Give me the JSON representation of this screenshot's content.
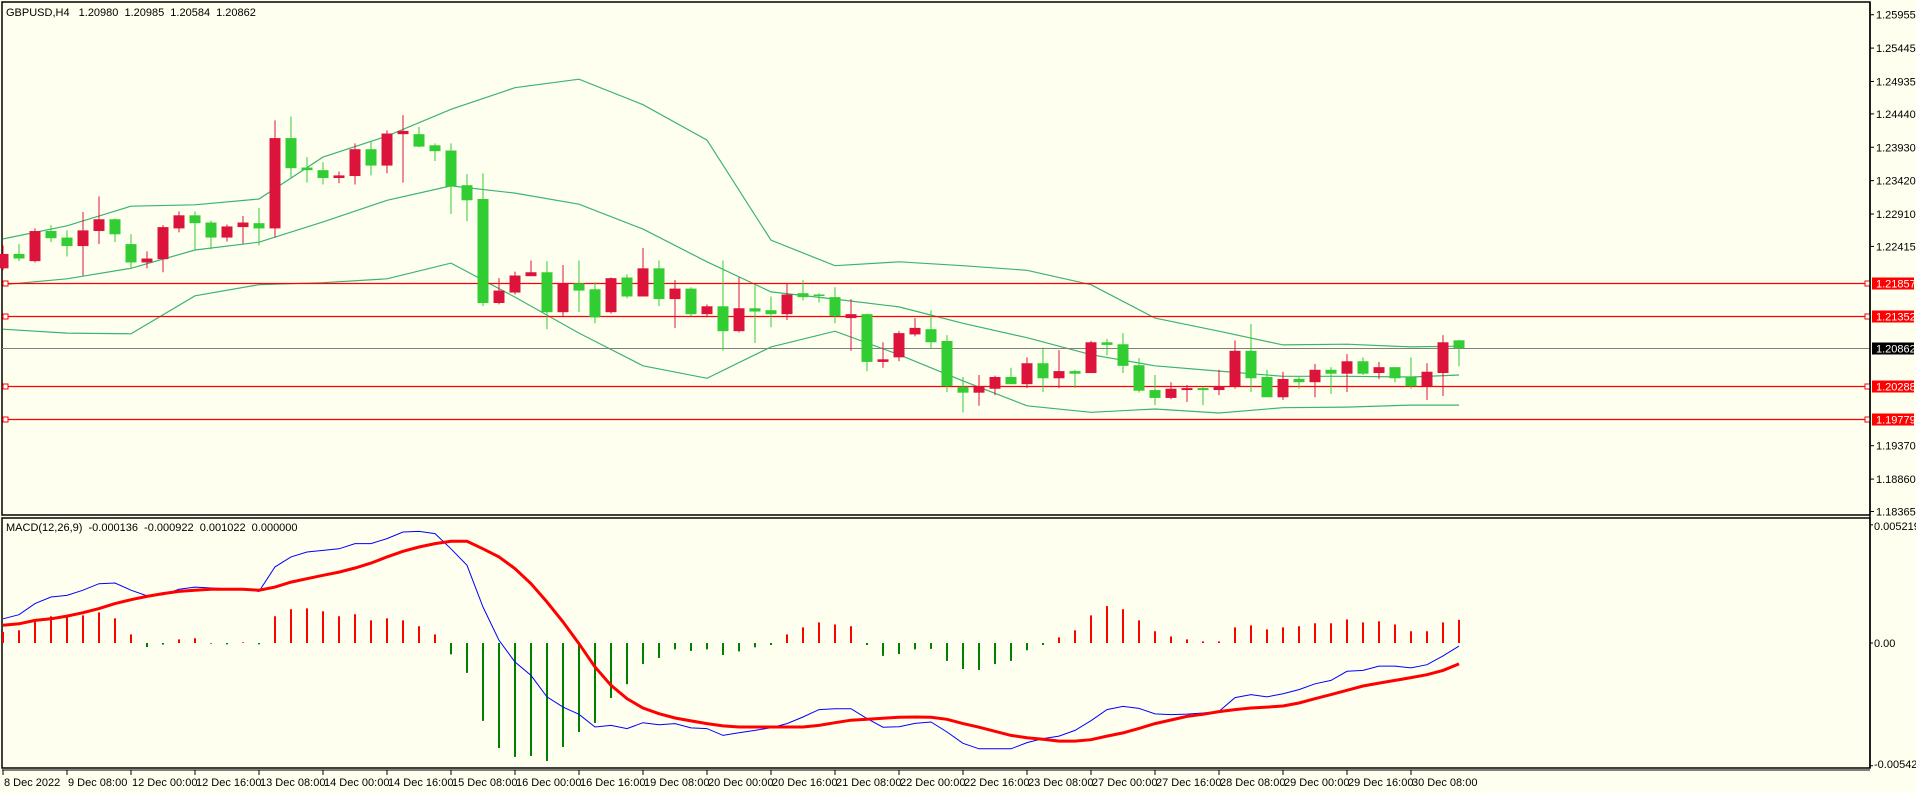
{
  "header": {
    "symbol": "GBPUSD,H4",
    "open": "1.20980",
    "high": "1.20985",
    "low": "1.20584",
    "close": "1.20862"
  },
  "macd_header": {
    "name": "MACD(12,26,9)",
    "v1": "-0.000136",
    "v2": "-0.000922",
    "v3": "0.001022",
    "v4": "0.000000"
  },
  "colors": {
    "background": "#fffff0",
    "bull_candle": "#dc143c",
    "bear_candle": "#32cd32",
    "bands": "#3cb371",
    "level_line": "#ff0000",
    "current_price_line": "#808080",
    "macd_main": "#0000ff",
    "macd_signal": "#ff0000",
    "hist_positive": "#ff0000",
    "hist_negative": "#008000"
  },
  "chart_data": {
    "type": "candlestick",
    "title": "GBPUSD,H4",
    "ylim": [
      1.18311,
      1.2618
    ],
    "price_axis": {
      "ticks": [
        "1.25955",
        "1.25445",
        "1.24935",
        "1.24440",
        "1.23930",
        "1.23420",
        "1.22910",
        "1.22415",
        "1.19370",
        "1.18860",
        "1.18365"
      ]
    },
    "levels": [
      {
        "price": 1.21857,
        "label": "1.21857"
      },
      {
        "price": 1.21352,
        "label": "1.21352"
      },
      {
        "price": 1.20288,
        "label": "1.20288"
      },
      {
        "price": 1.19779,
        "label": "1.19779"
      }
    ],
    "current_price": {
      "price": 1.20862,
      "label": "1.20862"
    },
    "time_axis": {
      "label_every_bars": 4,
      "labels": [
        "8 Dec 2022",
        "9 Dec 08:00",
        "12 Dec 00:00",
        "12 Dec 16:00",
        "13 Dec 08:00",
        "14 Dec 00:00",
        "14 Dec 16:00",
        "15 Dec 08:00",
        "16 Dec 00:00",
        "16 Dec 16:00",
        "19 Dec 08:00",
        "20 Dec 00:00",
        "20 Dec 16:00",
        "21 Dec 08:00",
        "22 Dec 00:00",
        "22 Dec 16:00",
        "23 Dec 08:00",
        "27 Dec 00:00",
        "27 Dec 16:00",
        "28 Dec 08:00",
        "29 Dec 00:00",
        "29 Dec 16:00",
        "30 Dec 08:00"
      ]
    },
    "ohlc": [
      [
        1.2208,
        1.2243,
        1.2205,
        1.223
      ],
      [
        1.223,
        1.2245,
        1.2219,
        1.2223
      ],
      [
        1.2219,
        1.2269,
        1.2217,
        1.2265
      ],
      [
        1.2265,
        1.2274,
        1.2248,
        1.2254
      ],
      [
        1.2255,
        1.2266,
        1.2226,
        1.2242
      ],
      [
        1.2242,
        1.2294,
        1.2197,
        1.2266
      ],
      [
        1.2265,
        1.2318,
        1.2245,
        1.2283
      ],
      [
        1.2283,
        1.2284,
        1.2248,
        1.226
      ],
      [
        1.2245,
        1.226,
        1.2208,
        1.2217
      ],
      [
        1.2217,
        1.2234,
        1.2208,
        1.2223
      ],
      [
        1.2222,
        1.2274,
        1.2202,
        1.2271
      ],
      [
        1.2269,
        1.2295,
        1.2263,
        1.2289
      ],
      [
        1.2289,
        1.2295,
        1.2237,
        1.2277
      ],
      [
        1.2278,
        1.2281,
        1.2237,
        1.2255
      ],
      [
        1.2255,
        1.2275,
        1.2249,
        1.2272
      ],
      [
        1.2271,
        1.2288,
        1.2246,
        1.2278
      ],
      [
        1.2277,
        1.23,
        1.2243,
        1.2269
      ],
      [
        1.2269,
        1.2434,
        1.2255,
        1.2407
      ],
      [
        1.2407,
        1.244,
        1.2347,
        1.2361
      ],
      [
        1.2362,
        1.2378,
        1.2339,
        1.2358
      ],
      [
        1.2358,
        1.237,
        1.2336,
        1.2346
      ],
      [
        1.2346,
        1.2356,
        1.2338,
        1.235
      ],
      [
        1.2349,
        1.2399,
        1.2336,
        1.239
      ],
      [
        1.239,
        1.2401,
        1.235,
        1.2365
      ],
      [
        1.2365,
        1.2419,
        1.2353,
        1.2414
      ],
      [
        1.2413,
        1.2442,
        1.2339,
        1.2418
      ],
      [
        1.2413,
        1.2424,
        1.2393,
        1.2394
      ],
      [
        1.2396,
        1.2399,
        1.2372,
        1.2387
      ],
      [
        1.2388,
        1.2399,
        1.2291,
        1.2333
      ],
      [
        1.2335,
        1.2352,
        1.228,
        1.2312
      ],
      [
        1.2314,
        1.2353,
        1.215,
        1.2155
      ],
      [
        1.2155,
        1.2193,
        1.2153,
        1.2174
      ],
      [
        1.2171,
        1.2203,
        1.2168,
        1.2197
      ],
      [
        1.2196,
        1.222,
        1.2196,
        1.2202
      ],
      [
        1.2202,
        1.2219,
        1.2115,
        1.2141
      ],
      [
        1.2141,
        1.2213,
        1.2135,
        1.2185
      ],
      [
        1.2185,
        1.222,
        1.2141,
        1.2174
      ],
      [
        1.2176,
        1.2187,
        1.2124,
        1.2133
      ],
      [
        1.2141,
        1.2194,
        1.2139,
        1.2193
      ],
      [
        1.2194,
        1.2199,
        1.2162,
        1.2165
      ],
      [
        1.2165,
        1.2239,
        1.2165,
        1.2208
      ],
      [
        1.2208,
        1.222,
        1.215,
        1.2161
      ],
      [
        1.2161,
        1.219,
        1.2117,
        1.2177
      ],
      [
        1.2177,
        1.2179,
        1.2135,
        1.2138
      ],
      [
        1.2138,
        1.2153,
        1.2133,
        1.215
      ],
      [
        1.215,
        1.222,
        1.2082,
        1.2112
      ],
      [
        1.2112,
        1.2194,
        1.211,
        1.2147
      ],
      [
        1.2147,
        1.2182,
        1.2094,
        1.2142
      ],
      [
        1.2144,
        1.2165,
        1.2118,
        1.2138
      ],
      [
        1.2138,
        1.2185,
        1.2129,
        1.2168
      ],
      [
        1.217,
        1.219,
        1.2159,
        1.2164
      ],
      [
        1.2168,
        1.217,
        1.2156,
        1.2167
      ],
      [
        1.2164,
        1.2179,
        1.2124,
        1.2135
      ],
      [
        1.2132,
        1.2161,
        1.2082,
        1.2138
      ],
      [
        1.2138,
        1.2139,
        1.2051,
        1.2065
      ],
      [
        1.2065,
        1.2095,
        1.2056,
        1.2069
      ],
      [
        1.2072,
        1.2112,
        1.2066,
        1.2109
      ],
      [
        1.2107,
        1.2132,
        1.2104,
        1.2117
      ],
      [
        1.2115,
        1.2144,
        1.2085,
        1.2095
      ],
      [
        1.2097,
        1.2106,
        1.2019,
        1.2028
      ],
      [
        1.2027,
        1.2042,
        1.1988,
        1.2018
      ],
      [
        1.2018,
        1.2045,
        1.1998,
        1.2027
      ],
      [
        1.2024,
        1.2044,
        1.2014,
        1.2042
      ],
      [
        1.2042,
        1.2056,
        1.2031,
        1.2031
      ],
      [
        1.2031,
        1.2072,
        1.2025,
        1.2063
      ],
      [
        1.2063,
        1.2087,
        1.2019,
        1.204
      ],
      [
        1.204,
        1.2083,
        1.2025,
        1.2051
      ],
      [
        1.2051,
        1.2053,
        1.2025,
        1.2047
      ],
      [
        1.2048,
        1.2097,
        1.2048,
        1.2095
      ],
      [
        1.2095,
        1.21,
        1.2075,
        1.2091
      ],
      [
        1.2092,
        1.2109,
        1.2048,
        1.2059
      ],
      [
        1.206,
        1.2071,
        1.2018,
        1.2021
      ],
      [
        1.2022,
        1.2045,
        1.1999,
        1.201
      ],
      [
        1.201,
        1.2034,
        1.2008,
        1.2024
      ],
      [
        1.2022,
        1.203,
        1.2004,
        1.2025
      ],
      [
        1.2025,
        1.2027,
        1.1999,
        1.2022
      ],
      [
        1.2022,
        1.2053,
        1.2014,
        1.2028
      ],
      [
        1.2028,
        1.2098,
        1.2024,
        1.2082
      ],
      [
        1.2082,
        1.2123,
        1.2019,
        1.204
      ],
      [
        1.2042,
        1.2053,
        1.2011,
        1.2011
      ],
      [
        1.2011,
        1.205,
        1.2007,
        1.2039
      ],
      [
        1.2039,
        1.2042,
        1.2024,
        1.2034
      ],
      [
        1.2034,
        1.2062,
        1.2011,
        1.2053
      ],
      [
        1.2053,
        1.2057,
        1.2016,
        1.2047
      ],
      [
        1.2047,
        1.2077,
        1.2019,
        1.2066
      ],
      [
        1.2066,
        1.2072,
        1.2045,
        1.2047
      ],
      [
        1.2048,
        1.2065,
        1.2039,
        1.2057
      ],
      [
        1.2057,
        1.2057,
        1.2034,
        1.204
      ],
      [
        1.2042,
        1.2072,
        1.2024,
        1.2028
      ],
      [
        1.2028,
        1.2063,
        1.2007,
        1.205
      ],
      [
        1.2048,
        1.2106,
        1.2013,
        1.2095
      ],
      [
        1.2098,
        1.20985,
        1.20584,
        1.20862
      ]
    ],
    "bollinger": {
      "sample_bars": [
        0,
        4,
        8,
        12,
        16,
        20,
        24,
        28,
        32,
        36,
        40,
        44,
        48,
        52,
        56,
        60,
        64,
        68,
        72,
        76,
        80,
        84,
        88,
        91
      ],
      "upper": [
        1.2253,
        1.2273,
        1.2303,
        1.2305,
        1.2314,
        1.2378,
        1.241,
        1.2451,
        1.2484,
        1.2497,
        1.2458,
        1.2404,
        1.2251,
        1.2212,
        1.2218,
        1.2212,
        1.2205,
        1.2183,
        1.2132,
        1.2112,
        1.2091,
        1.2092,
        1.2088,
        1.2089
      ],
      "middle": [
        1.2183,
        1.2192,
        1.2208,
        1.2236,
        1.2248,
        1.2279,
        1.2312,
        1.2334,
        1.2323,
        1.2306,
        1.2268,
        1.2218,
        1.2172,
        1.2161,
        1.2149,
        1.2124,
        1.2102,
        1.2076,
        1.2059,
        1.2051,
        1.2043,
        1.2043,
        1.2042,
        1.2045
      ],
      "lower": [
        1.2115,
        1.2109,
        1.2108,
        1.2166,
        1.2183,
        1.2186,
        1.2192,
        1.2216,
        1.2164,
        1.2109,
        1.2059,
        1.204,
        1.2088,
        1.2112,
        1.2076,
        1.2036,
        1.1998,
        1.1988,
        1.1993,
        1.1987,
        1.1995,
        1.1996,
        1.1999,
        1.1999
      ]
    },
    "macd": {
      "title": "MACD(12,26,9)",
      "ylim": [
        -0.00552,
        0.00552
      ],
      "ticks": [
        {
          "value": 0.005219,
          "label": "0.005219"
        },
        {
          "value": 0,
          "label": "0.00"
        },
        {
          "value": -0.00542,
          "label": "-0.00542"
        }
      ],
      "histogram": [
        0.00049,
        0.00056,
        0.00099,
        0.00118,
        0.00115,
        0.00122,
        0.00135,
        0.00109,
        0.00038,
        -0.00018,
        -7e-05,
        0.00016,
        0.00021,
        -3e-05,
        -6e-05,
        3e-05,
        -6e-05,
        0.00118,
        0.00149,
        0.00153,
        0.0014,
        0.00118,
        0.00127,
        0.001,
        0.00109,
        0.001,
        0.00074,
        0.00038,
        -0.0005,
        -0.00132,
        -0.00344,
        -0.00464,
        -0.00503,
        -0.00499,
        -0.00521,
        -0.00459,
        -0.00393,
        -0.00353,
        -0.00243,
        -0.00182,
        -0.00093,
        -0.00066,
        -0.00028,
        -0.00035,
        -0.00028,
        -0.00053,
        -0.00037,
        -0.00019,
        -9e-05,
        0.00038,
        0.00069,
        0.00091,
        0.00082,
        0.00074,
        -9e-05,
        -0.00057,
        -0.00049,
        -0.00028,
        -0.00026,
        -0.00079,
        -0.00115,
        -0.00119,
        -0.00093,
        -0.00079,
        -0.00032,
        -9e-05,
        0.00025,
        0.00056,
        0.00122,
        0.00163,
        0.00149,
        0.001,
        0.00052,
        0.00029,
        0.00016,
        7e-05,
        7e-05,
        0.00069,
        0.00078,
        0.0006,
        0.00069,
        0.00074,
        0.00087,
        0.00087,
        0.00104,
        0.00091,
        0.00096,
        0.00082,
        0.00052,
        0.00052,
        0.00091,
        0.001022
      ],
      "main": [
        0.00107,
        0.00125,
        0.00174,
        0.00203,
        0.0021,
        0.00233,
        0.00262,
        0.00265,
        0.00233,
        0.00208,
        0.00213,
        0.00237,
        0.00247,
        0.00243,
        0.0024,
        0.0024,
        0.00228,
        0.00336,
        0.0038,
        0.00402,
        0.00409,
        0.00416,
        0.00439,
        0.00439,
        0.00461,
        0.0049,
        0.00493,
        0.00483,
        0.00416,
        0.00343,
        0.00159,
        0.00012,
        -0.00084,
        -0.00143,
        -0.00238,
        -0.00283,
        -0.00315,
        -0.00371,
        -0.00364,
        -0.00378,
        -0.00352,
        -0.00361,
        -0.00356,
        -0.00375,
        -0.00378,
        -0.00408,
        -0.00396,
        -0.00386,
        -0.00374,
        -0.00356,
        -0.00327,
        -0.00294,
        -0.0029,
        -0.0029,
        -0.00334,
        -0.00372,
        -0.0037,
        -0.00355,
        -0.00349,
        -0.00393,
        -0.00443,
        -0.00467,
        -0.00467,
        -0.00467,
        -0.0044,
        -0.00422,
        -0.00411,
        -0.00386,
        -0.00343,
        -0.00294,
        -0.0028,
        -0.00289,
        -0.00313,
        -0.00316,
        -0.00314,
        -0.00309,
        -0.00302,
        -0.00241,
        -0.00228,
        -0.00238,
        -0.00224,
        -0.00206,
        -0.0018,
        -0.00165,
        -0.00125,
        -0.00121,
        -0.00102,
        -0.00102,
        -0.0011,
        -0.00096,
        -0.00057,
        -0.000136
      ],
      "signal": [
        0.00078,
        0.00085,
        0.001,
        0.00107,
        0.00119,
        0.00134,
        0.00152,
        0.00174,
        0.00191,
        0.00206,
        0.00218,
        0.00228,
        0.00233,
        0.00237,
        0.00237,
        0.00237,
        0.00233,
        0.00247,
        0.00269,
        0.00284,
        0.00299,
        0.00313,
        0.00331,
        0.00353,
        0.0038,
        0.00405,
        0.00424,
        0.00439,
        0.00449,
        0.00449,
        0.00416,
        0.0038,
        0.00328,
        0.00262,
        0.00181,
        0.00093,
        -3e-05,
        -0.00106,
        -0.00187,
        -0.00246,
        -0.00287,
        -0.00312,
        -0.00331,
        -0.00344,
        -0.00356,
        -0.00366,
        -0.00371,
        -0.00371,
        -0.00371,
        -0.00371,
        -0.00371,
        -0.00364,
        -0.00352,
        -0.00341,
        -0.00337,
        -0.00332,
        -0.00328,
        -0.00327,
        -0.00328,
        -0.00337,
        -0.00356,
        -0.00372,
        -0.0039,
        -0.00408,
        -0.00418,
        -0.00425,
        -0.00433,
        -0.00433,
        -0.00427,
        -0.00411,
        -0.00397,
        -0.00377,
        -0.00356,
        -0.0034,
        -0.00324,
        -0.00315,
        -0.00303,
        -0.00294,
        -0.00287,
        -0.00283,
        -0.00278,
        -0.00265,
        -0.00246,
        -0.00228,
        -0.00209,
        -0.0019,
        -0.00177,
        -0.00165,
        -0.00153,
        -0.0014,
        -0.00121,
        -0.000922
      ]
    }
  }
}
